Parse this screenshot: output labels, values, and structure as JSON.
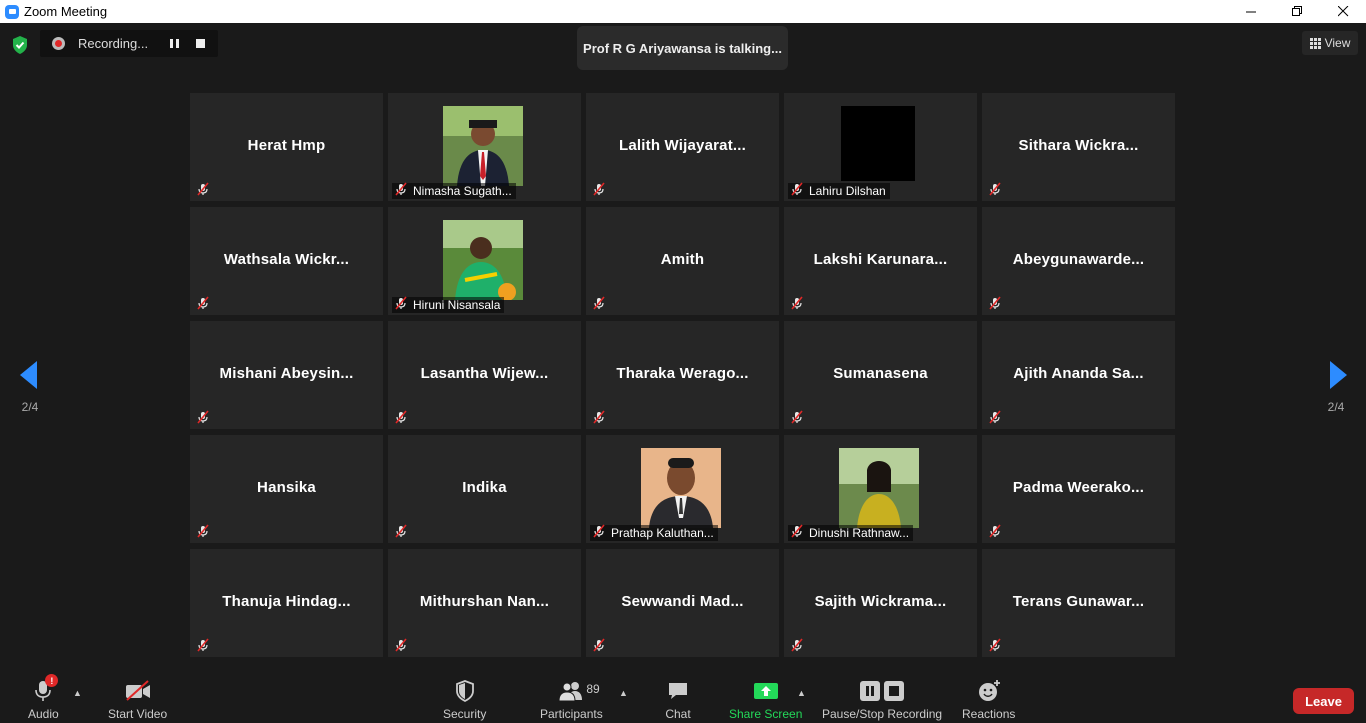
{
  "window": {
    "title": "Zoom Meeting"
  },
  "recording": {
    "label": "Recording..."
  },
  "talking": {
    "text": "Prof R G Ariyawansa is talking..."
  },
  "view": {
    "label": "View"
  },
  "paging": {
    "left": "2/4",
    "right": "2/4"
  },
  "participants_grid": [
    {
      "name": "Herat Hmp",
      "label": "",
      "photo": false
    },
    {
      "name": "",
      "label": "Nimasha Sugath...",
      "photo": "p-man-red"
    },
    {
      "name": "Lalith Wijayarat...",
      "label": "",
      "photo": false
    },
    {
      "name": "",
      "label": "Lahiru Dilshan",
      "photo": "p-black"
    },
    {
      "name": "Sithara Wickra...",
      "label": "",
      "photo": false
    },
    {
      "name": "Wathsala Wickr...",
      "label": "",
      "photo": false
    },
    {
      "name": "",
      "label": "Hiruni Nisansala",
      "photo": "p-green"
    },
    {
      "name": "Amith",
      "label": "",
      "photo": false
    },
    {
      "name": "Lakshi Karunara...",
      "label": "",
      "photo": false
    },
    {
      "name": "Abeygunawarde...",
      "label": "",
      "photo": false
    },
    {
      "name": "Mishani Abeysin...",
      "label": "",
      "photo": false
    },
    {
      "name": "Lasantha Wijew...",
      "label": "",
      "photo": false
    },
    {
      "name": "Tharaka Werago...",
      "label": "",
      "photo": false
    },
    {
      "name": "Sumanasena",
      "label": "",
      "photo": false
    },
    {
      "name": "Ajith Ananda Sa...",
      "label": "",
      "photo": false
    },
    {
      "name": "Hansika",
      "label": "",
      "photo": false
    },
    {
      "name": "Indika",
      "label": "",
      "photo": false
    },
    {
      "name": "",
      "label": "Prathap Kaluthan...",
      "photo": "p-suit"
    },
    {
      "name": "",
      "label": "Dinushi Rathnaw...",
      "photo": "p-yellow"
    },
    {
      "name": "Padma Weerako...",
      "label": "",
      "photo": false
    },
    {
      "name": "Thanuja Hindag...",
      "label": "",
      "photo": false
    },
    {
      "name": "Mithurshan Nan...",
      "label": "",
      "photo": false
    },
    {
      "name": "Sewwandi Mad...",
      "label": "",
      "photo": false
    },
    {
      "name": "Sajith Wickrama...",
      "label": "",
      "photo": false
    },
    {
      "name": "Terans Gunawar...",
      "label": "",
      "photo": false
    }
  ],
  "toolbar": {
    "audio": "Audio",
    "audio_badge": "!",
    "video": "Start Video",
    "security": "Security",
    "participants": "Participants",
    "participants_count": "89",
    "chat": "Chat",
    "share": "Share Screen",
    "recording": "Pause/Stop Recording",
    "reactions": "Reactions",
    "leave": "Leave"
  },
  "colors": {
    "accent": "#2d8cff",
    "share": "#23d959",
    "leave": "#c62828",
    "mute": "#e02828"
  }
}
